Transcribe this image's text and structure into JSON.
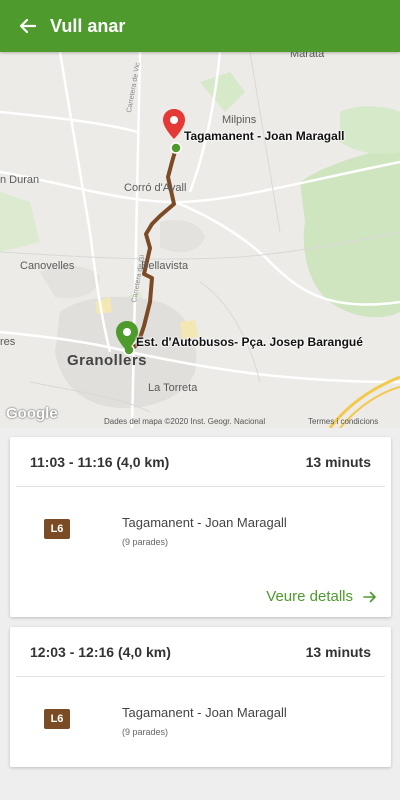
{
  "appbar": {
    "title": "Vull anar"
  },
  "map": {
    "labels": {
      "marata": "Marata",
      "milpins": "Milpins",
      "can_duran": "n Duran",
      "corro_davall": "Corró d'Avall",
      "canovelles": "Canovelles",
      "bellavista": "Bellavista",
      "res": "res",
      "granollers": "Granollers",
      "la_torreta": "La Torreta",
      "road1": "Carretera de Vic",
      "road2": "Carretera de Gi"
    },
    "origin_label": "Est. d'Autobusos- Pça. Josep Barangué",
    "destination_label": "Tagamanent - Joan Maragall",
    "attribution": "Dades del mapa ©2020 Inst. Geogr. Nacional",
    "terms": "Termes i condicions",
    "google": "Google",
    "colors": {
      "route": "#7b4b26",
      "origin_pin": "#4e9a2d",
      "destination_pin": "#e53935"
    }
  },
  "routes": [
    {
      "time": "11:03 - 11:16 (4,0 km)",
      "duration": "13 minuts",
      "line": "L6",
      "line_color": "#7b4b26",
      "stop": "Tagamanent - Joan Maragall",
      "stops_count": "(9 parades)",
      "details_label": "Veure detalls"
    },
    {
      "time": "12:03 - 12:16 (4,0 km)",
      "duration": "13 minuts",
      "line": "L6",
      "line_color": "#7b4b26",
      "stop": "Tagamanent - Joan Maragall",
      "stops_count": "(9 parades)"
    }
  ]
}
